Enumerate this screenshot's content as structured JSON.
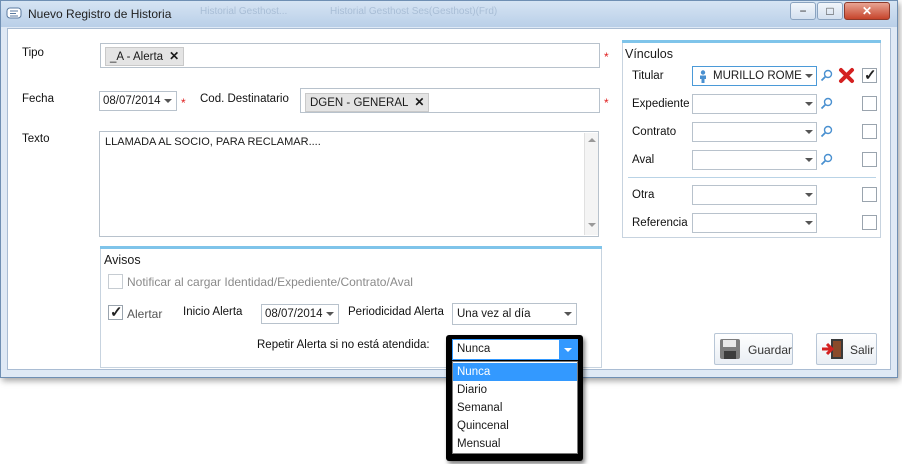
{
  "window": {
    "title": "Nuevo Registro de Historia",
    "ghost_tabs": [
      "Historial Gesthost...",
      "Historial Gesthost Ses(Gesthost)(Frd)"
    ],
    "controls": [
      "−",
      "□",
      "✕"
    ]
  },
  "form": {
    "tipo_label": "Tipo",
    "tipo_value": "_A - Alerta",
    "fecha_label": "Fecha",
    "fecha_value": "08/07/2014",
    "destinatario_label": "Cod. Destinatario",
    "destinatario_value": "DGEN - GENERAL",
    "texto_label": "Texto",
    "texto_value": "LLAMADA AL SOCIO, PARA RECLAMAR....",
    "required_mark": "*",
    "remove_mark": "✕"
  },
  "vinculos": {
    "title": "Vínculos",
    "rows": [
      {
        "label": "Titular",
        "value": "MURILLO ROME",
        "checked": true
      },
      {
        "label": "Expediente",
        "value": "",
        "checked": false
      },
      {
        "label": "Contrato",
        "value": "",
        "checked": false
      },
      {
        "label": "Aval",
        "value": "",
        "checked": false
      },
      {
        "label": "Otra",
        "value": "",
        "checked": false
      },
      {
        "label": "Referencia",
        "value": "",
        "checked": false
      }
    ]
  },
  "avisos": {
    "title": "Avisos",
    "notificar_label": "Notificar al cargar Identidad/Expediente/Contrato/Aval",
    "alertar_label": "Alertar",
    "inicio_label": "Inicio Alerta",
    "inicio_value": "08/07/2014",
    "periodicidad_label": "Periodicidad Alerta",
    "periodicidad_value": "Una vez al día",
    "repetir_label": "Repetir Alerta si no está atendida:",
    "repetir_value": "Nunca",
    "repetir_options": [
      "Nunca",
      "Diario",
      "Semanal",
      "Quincenal",
      "Mensual"
    ]
  },
  "actions": {
    "guardar": "Guardar",
    "salir": "Salir"
  },
  "colors": {
    "accent": "#7fc4ea",
    "selected": "#3399ff",
    "required": "#e02020",
    "delete": "#d42020"
  }
}
